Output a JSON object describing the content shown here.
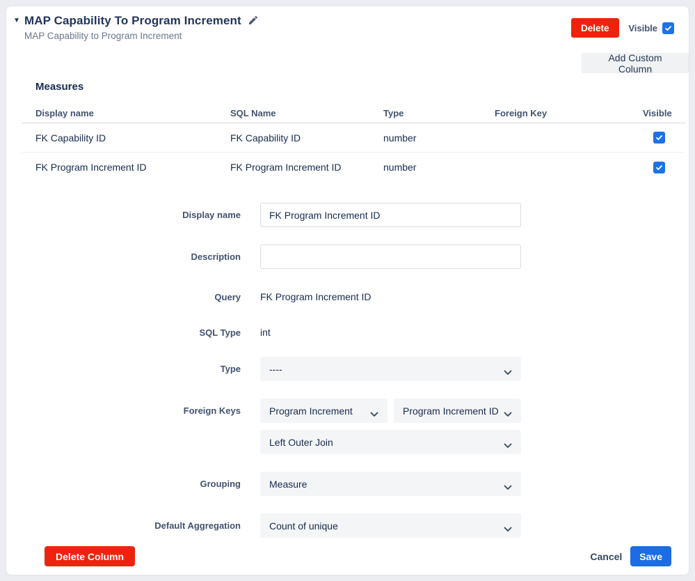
{
  "window": {
    "title": "MAP Capability To Program Increment",
    "subtitle": "MAP Capability to Program Increment"
  },
  "icons": {
    "collapse": "▼"
  },
  "header": {
    "delete_label": "Delete",
    "visible_label": "Visible",
    "visible_checked": true,
    "add_custom_column_label": "Add Custom Column"
  },
  "measures": {
    "heading": "Measures",
    "columns": {
      "display_name": "Display name",
      "sql_name": "SQL Name",
      "type": "Type",
      "foreign_key": "Foreign Key",
      "visible": "Visible"
    },
    "rows": [
      {
        "display_name": "FK Capability ID",
        "sql_name": "FK Capability ID",
        "type": "number",
        "foreign_key": "",
        "visible": true
      },
      {
        "display_name": "FK Program Increment ID",
        "sql_name": "FK Program Increment ID",
        "type": "number",
        "foreign_key": "",
        "visible": true
      }
    ]
  },
  "form": {
    "display_name": {
      "label": "Display name",
      "value": "FK Program Increment ID"
    },
    "description": {
      "label": "Description",
      "value": "",
      "placeholder": ""
    },
    "query": {
      "label": "Query",
      "value": "FK Program Increment ID"
    },
    "sql_type": {
      "label": "SQL Type",
      "value": "int"
    },
    "type": {
      "label": "Type",
      "value": "----"
    },
    "foreign_keys": {
      "label": "Foreign Keys",
      "table_value": "Program Increment",
      "column_value": "Program Increment ID",
      "join_value": "Left Outer Join"
    },
    "grouping": {
      "label": "Grouping",
      "value": "Measure"
    },
    "default_aggregation": {
      "label": "Default Aggregation",
      "value": "Count of unique"
    }
  },
  "footer": {
    "delete_column_label": "Delete Column",
    "cancel_label": "Cancel",
    "save_label": "Save"
  },
  "colors": {
    "danger": "#ee230d",
    "primary": "#1b6ce5",
    "checkbox_accent": "#1d72e8",
    "title_text": "#22355c",
    "label_text": "#42526e",
    "body_text": "#172b4d",
    "muted_text": "#6b778c",
    "select_bg": "#f4f5f7"
  }
}
